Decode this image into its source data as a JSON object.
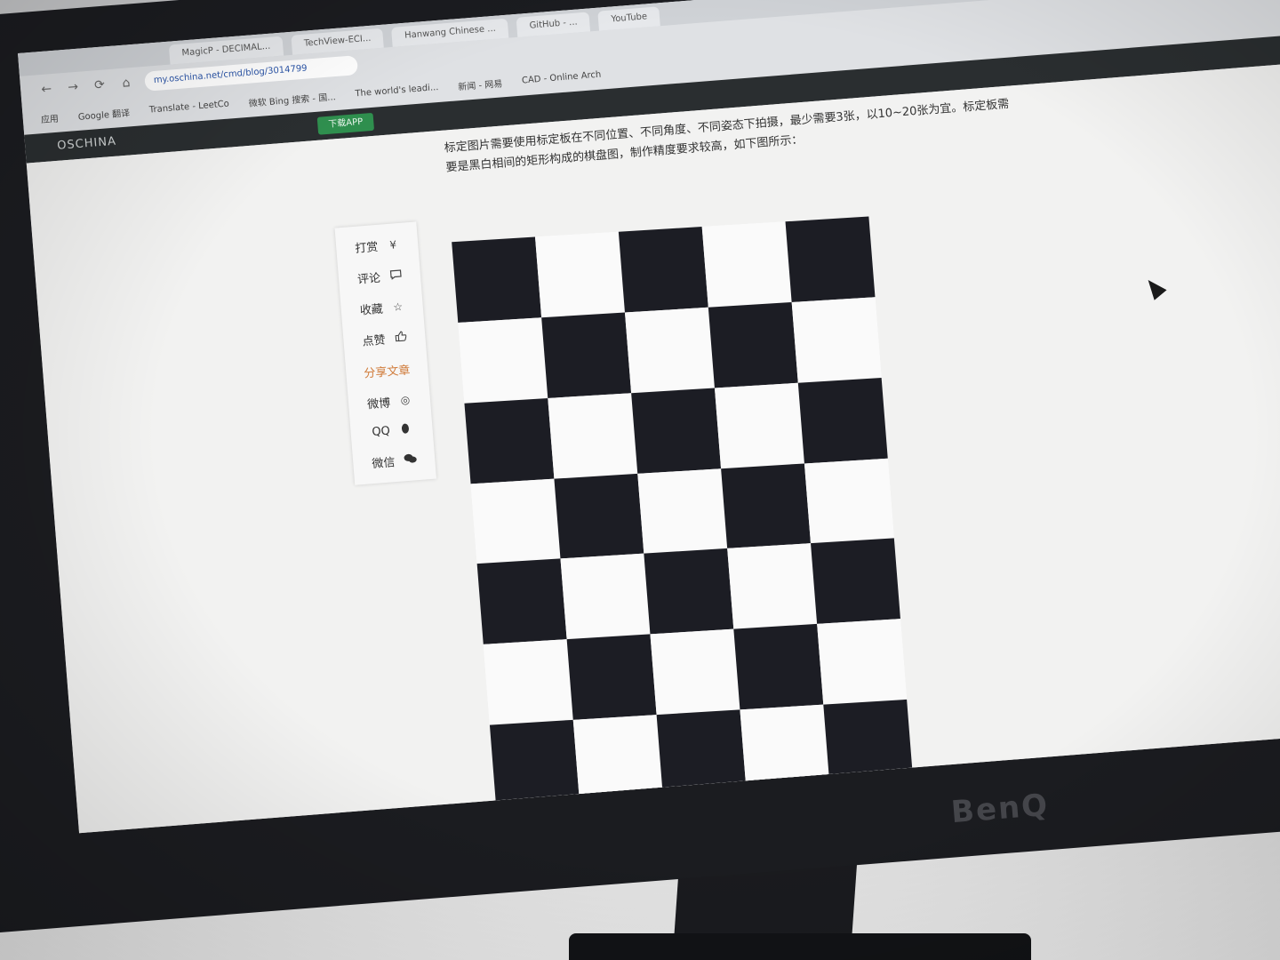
{
  "browser": {
    "tabs": [
      "MagicP - DECIMAL...",
      "TechView-ECI...",
      "Hanwang Chinese ...",
      "GitHub - ...",
      "YouTube"
    ],
    "address": "my.oschina.net/cmd/blog/3014799",
    "bookmarks": [
      "应用",
      "Google 翻译",
      "Translate - LeetCo",
      "微软 Bing 搜索 - 国...",
      "The world's leadi...",
      "新闻 - 网易",
      "CAD - Online Arch"
    ]
  },
  "site": {
    "logo": "OSCHINA",
    "download_label": "下载APP"
  },
  "article": {
    "text_line_1": "标定图片需要使用标定板在不同位置、不同角度、不同姿态下拍摄，最少需要3张，以10~20张为宜。标定板需",
    "text_line_2": "要是黑白相间的矩形构成的棋盘图，制作精度要求较高，如下图所示："
  },
  "side_toolbar": {
    "items": [
      {
        "label": "打赏",
        "icon": "yen-icon"
      },
      {
        "label": "评论",
        "icon": "comment-icon"
      },
      {
        "label": "收藏",
        "icon": "star-icon"
      },
      {
        "label": "点赞",
        "icon": "thumbs-up-icon"
      },
      {
        "label": "分享文章",
        "icon": ""
      },
      {
        "label": "微博",
        "icon": "weibo-icon"
      },
      {
        "label": "QQ",
        "icon": "qq-icon"
      },
      {
        "label": "微信",
        "icon": "wechat-icon"
      }
    ],
    "icon_glyphs": [
      "¥",
      "💬",
      "☆",
      "👍",
      "",
      "◎",
      "●",
      "●"
    ]
  },
  "monitor": {
    "brand": "BenQ"
  },
  "colors": {
    "board_dark": "#1c1d24",
    "board_light": "#fafafa",
    "highlight": "#d07b3a",
    "site_header": "#2a2e30"
  }
}
